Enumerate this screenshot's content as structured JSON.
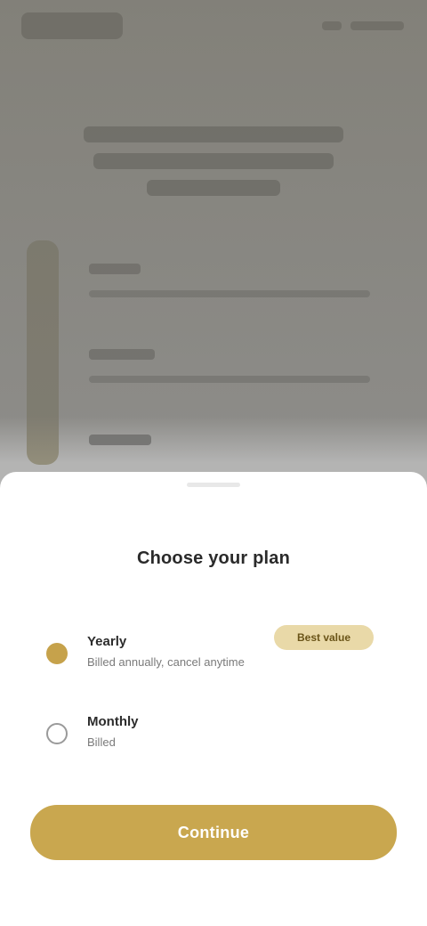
{
  "sheet": {
    "title": "Choose your plan",
    "options": [
      {
        "label": "Yearly",
        "sub": "Billed annually, cancel anytime",
        "badge": "Best value",
        "selected": true
      },
      {
        "label": "Monthly",
        "sub": "Billed",
        "selected": false
      }
    ],
    "cta_label": "Continue"
  },
  "colors": {
    "accent": "#c9a74f",
    "badge_bg": "#e9d9a8",
    "scrim": "#7c7b77"
  }
}
